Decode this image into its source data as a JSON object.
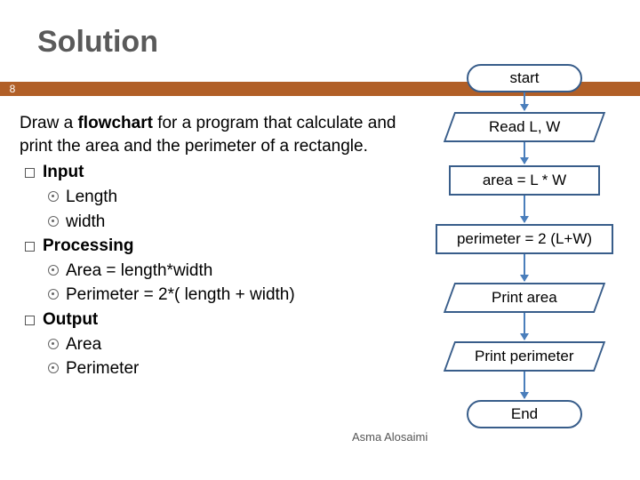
{
  "title": "Solution",
  "page_number": "8",
  "footer": "Asma Alosaimi",
  "body": {
    "para1_pre": "Draw a ",
    "para1_bold": "flowchart",
    "para1_post": " for a program that calculate and print the  area and the perimeter of a rectangle.",
    "input_label": "Input",
    "input_items": [
      "Length",
      "width"
    ],
    "processing_label": "Processing",
    "processing_items": [
      "Area = length*width",
      "Perimeter = 2*( length + width)"
    ],
    "output_label": "Output",
    "output_items": [
      "Area",
      "Perimeter"
    ]
  },
  "flow": {
    "start": "start",
    "read": "Read L, W",
    "area": "area = L * W",
    "perimeter": "perimeter = 2 (L+W)",
    "print_area": "Print area",
    "print_perimeter": "Print perimeter",
    "end": "End"
  }
}
